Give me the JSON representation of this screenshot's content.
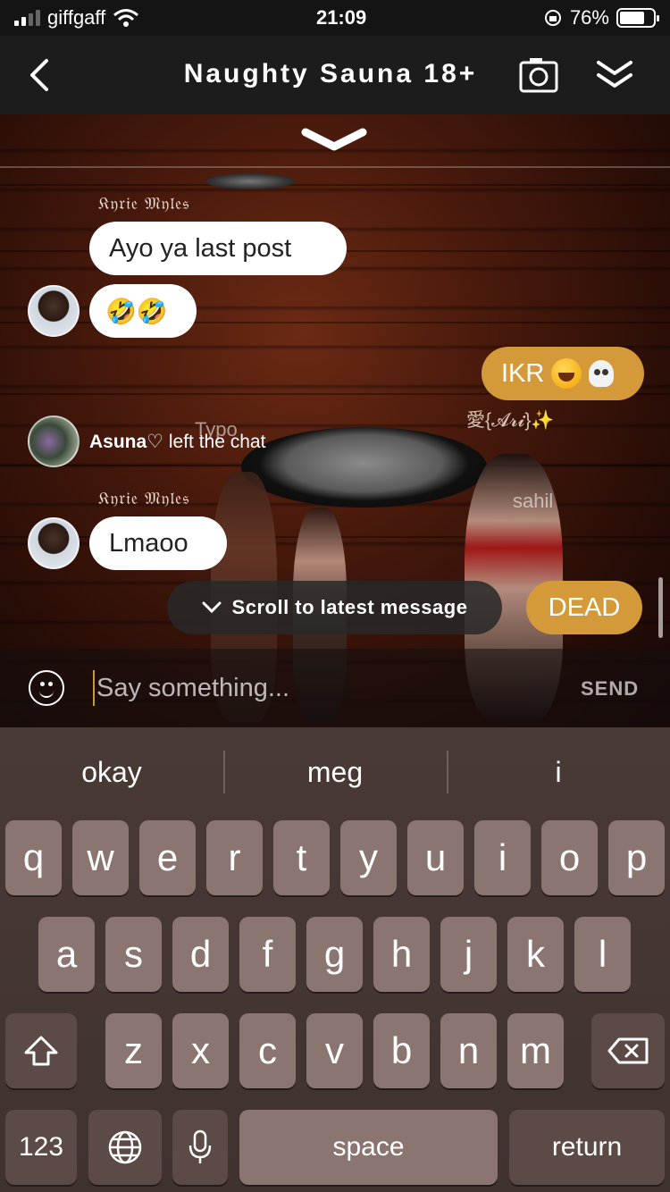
{
  "status_bar": {
    "carrier": "giffgaff",
    "time": "21:09",
    "battery_percent": "76%",
    "battery_level": 0.76
  },
  "header": {
    "title": "Naughty Sauna 18+"
  },
  "scene": {
    "label_typo": "Typo",
    "label_sahil": "sahil",
    "label_ari": "愛{𝓐𝓻𝓲}✨"
  },
  "chat": {
    "msg1": {
      "sender": "𝔎𝔶𝔯𝔦𝔢 𝔐𝔶𝔩𝔢𝔰",
      "text": "Ayo ya last post"
    },
    "msg2": {
      "emoji": "🤣🤣"
    },
    "msg3": {
      "text": "IKR"
    },
    "system": {
      "user": "Asuna♡",
      "text": " left the chat"
    },
    "msg4": {
      "sender": "𝔎𝔶𝔯𝔦𝔢 𝔐𝔶𝔩𝔢𝔰",
      "text": "Lmaoo"
    },
    "msg5": {
      "text": "DEAD"
    },
    "scroll_pill": "Scroll to latest message"
  },
  "input": {
    "placeholder": "Say something...",
    "send_label": "SEND"
  },
  "keyboard": {
    "suggestions": [
      "okay",
      "meg",
      "i"
    ],
    "row1": [
      "q",
      "w",
      "e",
      "r",
      "t",
      "y",
      "u",
      "i",
      "o",
      "p"
    ],
    "row2": [
      "a",
      "s",
      "d",
      "f",
      "g",
      "h",
      "j",
      "k",
      "l"
    ],
    "row3": [
      "z",
      "x",
      "c",
      "v",
      "b",
      "n",
      "m"
    ],
    "numbers_label": "123",
    "space_label": "space",
    "return_label": "return"
  },
  "colors": {
    "gold_bubble": "#d49a3a",
    "header_bg": "#1c1c1c"
  }
}
